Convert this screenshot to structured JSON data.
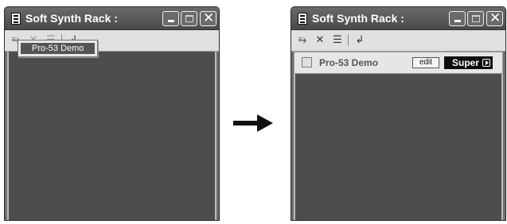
{
  "before": {
    "title": "Soft Synth Rack :",
    "popup_item": "Pro-53 Demo"
  },
  "after": {
    "title": "Soft Synth Rack :",
    "slot_name": "Pro-53 Demo",
    "edit_label": "edit",
    "super_label": "Super"
  },
  "icons": {
    "transition": "right-arrow-icon",
    "toolbar": [
      "insert-synth-icon",
      "delete-synth-icon",
      "properties-icon",
      "midi-icon"
    ]
  }
}
